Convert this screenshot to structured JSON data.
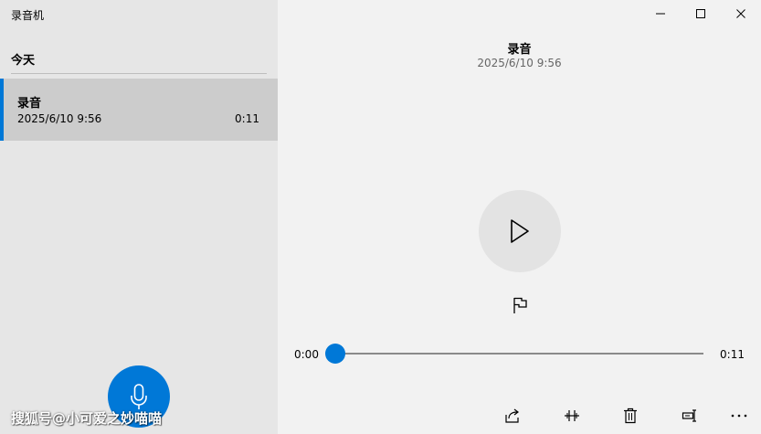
{
  "app": {
    "title": "录音机"
  },
  "list": {
    "group_header": "今天",
    "items": [
      {
        "name": "录音",
        "date": "2025/6/10 9:56",
        "duration": "0:11"
      }
    ]
  },
  "player": {
    "title": "录音",
    "date": "2025/6/10 9:56",
    "current_time": "0:00",
    "total_time": "0:11",
    "progress": 0
  },
  "watermark": "搜狐号@小可爱之妙喵喵",
  "icons": {
    "record": "microphone-icon",
    "play": "play-icon",
    "flag": "flag-icon",
    "share": "share-icon",
    "trim": "trim-icon",
    "delete": "trash-icon",
    "rename": "rename-icon",
    "more": "more-icon",
    "minimize": "minimize-icon",
    "maximize": "maximize-icon",
    "close": "close-icon"
  },
  "colors": {
    "accent": "#0078d7",
    "left_pane_bg": "#e6e6e6",
    "selected_item_bg": "#cccccc",
    "right_pane_bg": "#f2f2f2"
  }
}
